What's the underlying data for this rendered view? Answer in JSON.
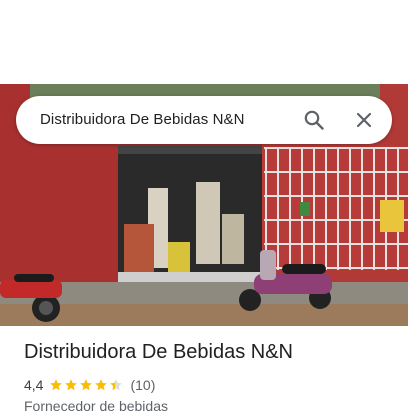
{
  "search": {
    "query": "Distribuidora De Bebidas N&N"
  },
  "place": {
    "name": "Distribuidora De Bebidas N&N",
    "rating": "4,4",
    "rating_value": 4.4,
    "review_count": "(10)",
    "category": "Fornecedor de bebidas"
  },
  "icons": {
    "search": "search-icon",
    "close": "close-icon",
    "star": "star-icon"
  },
  "colors": {
    "star": "#fbbc04",
    "title": "#202124",
    "secondary": "#5f6368"
  }
}
